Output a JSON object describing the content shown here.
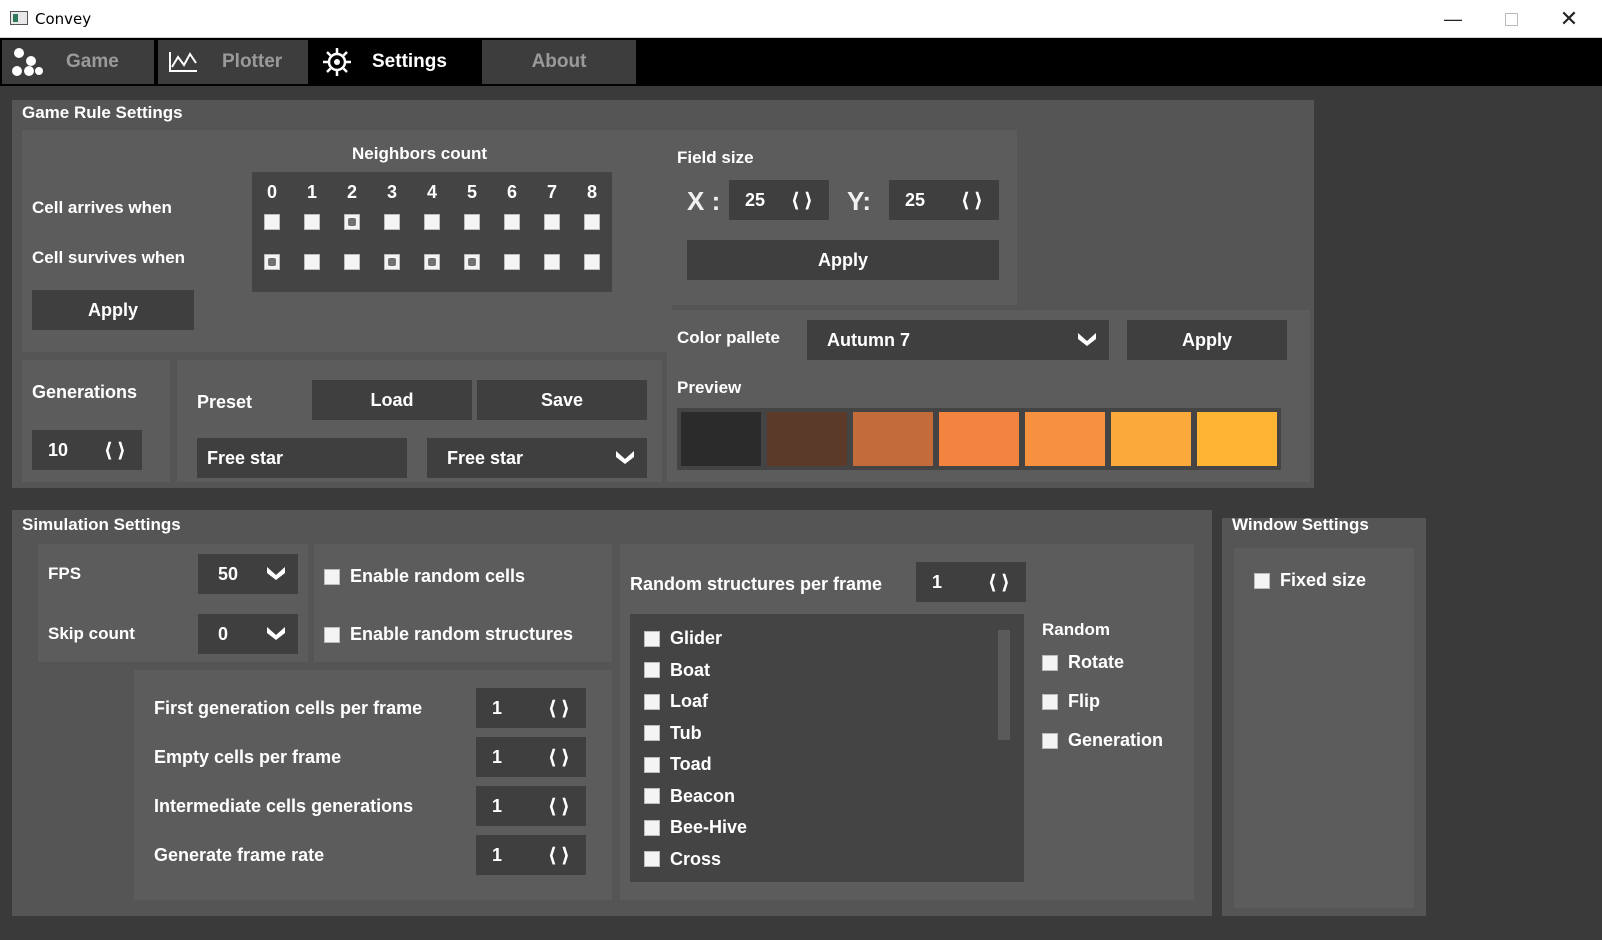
{
  "window": {
    "title": "Convey"
  },
  "tabs": [
    {
      "label": "Game",
      "icon": "cells-icon",
      "active": false
    },
    {
      "label": "Plotter",
      "icon": "plot-icon",
      "active": false
    },
    {
      "label": "Settings",
      "icon": "gear-icon",
      "active": true
    },
    {
      "label": "About",
      "icon": "",
      "active": false
    }
  ],
  "game_rules": {
    "title": "Game Rule Settings",
    "neighbors_header": "Neighbors count",
    "neighbor_numbers": [
      "0",
      "1",
      "2",
      "3",
      "4",
      "5",
      "6",
      "7",
      "8"
    ],
    "arrives_label": "Cell arrives when",
    "survives_label": "Cell survives when",
    "arrives_checked": [
      false,
      false,
      true,
      false,
      false,
      false,
      false,
      false,
      false
    ],
    "survives_checked": [
      true,
      false,
      false,
      true,
      true,
      true,
      false,
      false,
      false
    ],
    "apply_label": "Apply"
  },
  "field_size": {
    "title": "Field size",
    "x_label": "X :",
    "x_value": "25",
    "y_label": "Y:",
    "y_value": "25",
    "apply_label": "Apply"
  },
  "color_pallete": {
    "label": "Color pallete",
    "selected": "Autumn 7",
    "apply_label": "Apply",
    "preview_label": "Preview",
    "colors": [
      "#2b2b2b",
      "#5c3a2a",
      "#c46b3c",
      "#f28440",
      "#f6913f",
      "#fba93a",
      "#ffb533"
    ]
  },
  "generations": {
    "label": "Generations",
    "value": "10"
  },
  "preset": {
    "label": "Preset",
    "load_label": "Load",
    "save_label": "Save",
    "name_value": "Free star",
    "selected": "Free star"
  },
  "simulation": {
    "title": "Simulation Settings",
    "fps_label": "FPS",
    "fps_value": "50",
    "skip_label": "Skip count",
    "skip_value": "0",
    "enable_random_cells": "Enable random cells",
    "enable_random_structures": "Enable random structures",
    "first_gen_label": "First generation cells per frame",
    "first_gen_value": "1",
    "empty_cells_label": "Empty cells per frame",
    "empty_cells_value": "1",
    "intermediate_label": "Intermediate cells generations",
    "intermediate_value": "1",
    "frame_rate_label": "Generate frame rate",
    "frame_rate_value": "1",
    "rsp_label": "Random structures per frame",
    "rsp_value": "1",
    "structures": [
      "Glider",
      "Boat",
      "Loaf",
      "Tub",
      "Toad",
      "Beacon",
      "Bee-Hive",
      "Cross"
    ],
    "random_title": "Random",
    "random_options": [
      "Rotate",
      "Flip",
      "Generation"
    ]
  },
  "window_settings": {
    "title": "Window Settings",
    "fixed_size": "Fixed size"
  }
}
